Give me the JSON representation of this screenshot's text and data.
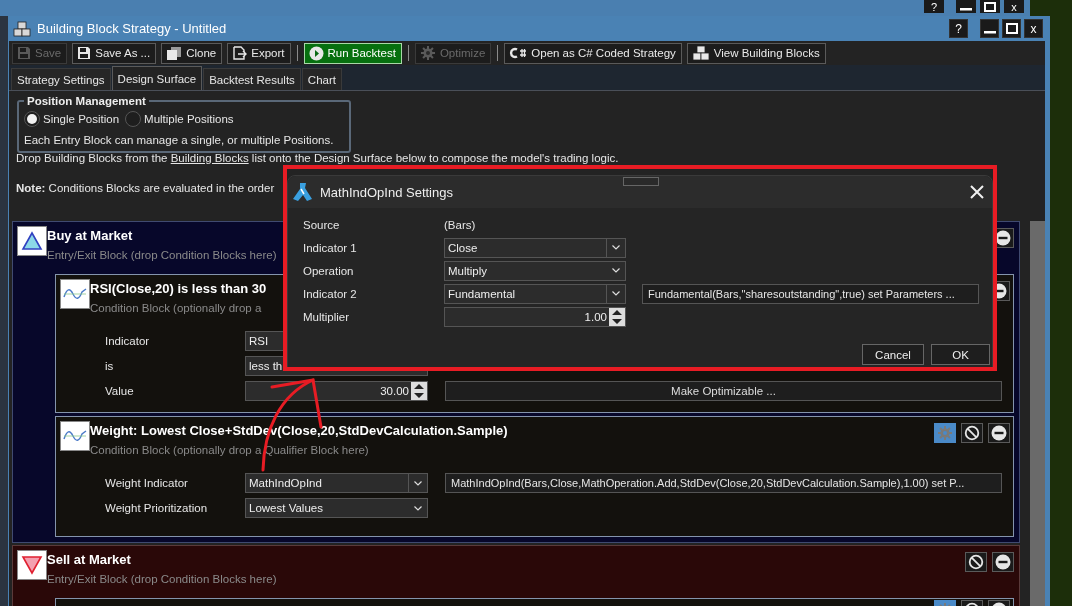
{
  "background_window": {
    "help": "?",
    "close": "x"
  },
  "window": {
    "title": "Building Block Strategy - Untitled",
    "help": "?",
    "close": "x"
  },
  "toolbar": [
    {
      "kind": "button",
      "label": "Save",
      "disabled": true
    },
    {
      "kind": "button",
      "label": "Save As ...",
      "disabled": false
    },
    {
      "kind": "button",
      "label": "Clone",
      "disabled": false
    },
    {
      "kind": "button",
      "label": "Export",
      "disabled": false
    },
    {
      "kind": "separator"
    },
    {
      "kind": "primary",
      "label": "Run Backtest",
      "disabled": false
    },
    {
      "kind": "separator"
    },
    {
      "kind": "button",
      "label": "Optimize",
      "disabled": true
    },
    {
      "kind": "separator"
    },
    {
      "kind": "button",
      "label": "Open as C# Coded Strategy",
      "disabled": false
    },
    {
      "kind": "button",
      "label": "View Building Blocks",
      "disabled": false
    }
  ],
  "tabs": [
    {
      "label": "Strategy Settings",
      "selected": false
    },
    {
      "label": "Design Surface",
      "selected": true
    },
    {
      "label": "Backtest Results",
      "selected": false
    },
    {
      "label": "Chart",
      "selected": false
    }
  ],
  "position_management": {
    "title": "Position Management",
    "options": [
      {
        "label": "Single Position",
        "selected": true
      },
      {
        "label": "Multiple Positions",
        "selected": false
      }
    ],
    "note": "Each Entry Block can manage a single, or multiple Positions."
  },
  "design_help": {
    "lead": "Drop Building Blocks from the",
    "link": "Building Blocks",
    "rest": "list onto the Design Surface below to compose the model's trading logic.",
    "note": "**Note:** Conditions Blocks are evaluated in the order"
  },
  "blocks": [
    {
      "kind": "buy",
      "title": "Buy at Market",
      "subtitle": "Entry/Exit Block (drop Condition Blocks here)",
      "buttons": [
        {
          "kind": "remove"
        }
      ],
      "conditions": [
        {
          "title": "RSI(Close,20) is less than 30",
          "subtitle": "Condition Block (optionally drop a",
          "buttons": [
            {
              "kind": "remove"
            }
          ],
          "fields": [
            {
              "label": "Indicator",
              "kind": "dropdown",
              "value": "RSI"
            },
            {
              "label": "is",
              "kind": "dropdown",
              "value": "less th"
            },
            {
              "label": "Value",
              "kind": "spinner",
              "value": "30.00",
              "action": "Make Optimizable ..."
            }
          ]
        },
        {
          "title": "Weight: Lowest Close+StdDev(Close,20,StdDevCalculation.Sample)",
          "subtitle": "Condition Block (optionally drop a Qualifier Block here)",
          "buttons": [
            {
              "kind": "settings"
            },
            {
              "kind": "disable"
            },
            {
              "kind": "remove"
            }
          ],
          "fields": [
            {
              "label": "Weight Indicator",
              "kind": "combo",
              "value": "MathIndOpInd",
              "detail": "MathIndOpInd(Bars,Close,MathOperation.Add,StdDev(Close,20,StdDevCalculation.Sample),1.00) set P..."
            },
            {
              "label": "Weight Prioritization",
              "kind": "dropdown",
              "value": "Lowest Values"
            }
          ]
        }
      ]
    },
    {
      "kind": "sell",
      "title": "Sell at Market",
      "subtitle": "Entry/Exit Block (drop Condition Blocks here)",
      "buttons": [
        {
          "kind": "disable"
        },
        {
          "kind": "remove"
        }
      ],
      "conditions": [
        {
          "buttons": [
            {
              "kind": "settings"
            },
            {
              "kind": "disable"
            },
            {
              "kind": "remove"
            }
          ]
        }
      ]
    }
  ],
  "dialog": {
    "title": "MathIndOpInd Settings",
    "fields": [
      {
        "label": "Source",
        "kind": "text",
        "value": "(Bars)"
      },
      {
        "label": "Indicator 1",
        "kind": "combo",
        "value": "Close"
      },
      {
        "label": "Operation",
        "kind": "dropdown",
        "value": "Multiply"
      },
      {
        "label": "Indicator 2",
        "kind": "combo",
        "value": "Fundamental",
        "detail": "Fundamental(Bars,\"sharesoutstanding\",true) set Parameters ..."
      },
      {
        "label": "Multiplier",
        "kind": "spinner",
        "value": "1.00"
      }
    ],
    "buttons": [
      "Cancel",
      "OK"
    ]
  }
}
